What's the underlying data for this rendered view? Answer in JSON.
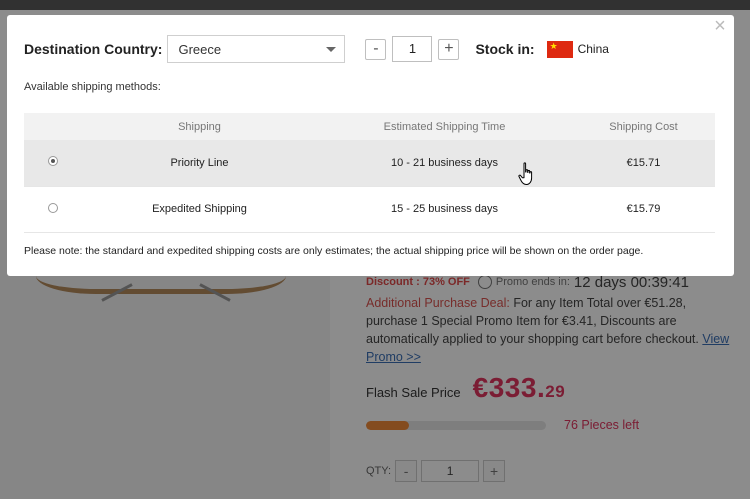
{
  "background": {
    "discount_text": "Discount : 73% OFF",
    "promo_ends_label": "Promo ends in:",
    "promo_ends_value": "12 days 00:39:41",
    "apd_title": "Additional Purchase Deal:",
    "apd_text": "For any Item Total over €51.28, purchase 1 Special Promo Item for €3.41, Discounts are automatically applied to your shopping cart before checkout.",
    "apd_link": "View Promo >>",
    "flash_label": "Flash Sale Price",
    "flash_price_main": "€333.",
    "flash_price_cents": "29",
    "pieces_left": "76 Pieces left",
    "progress_fraction": 0.24,
    "qty_label": "QTY:",
    "qty_value": "1",
    "minus": "-",
    "plus": "+"
  },
  "modal": {
    "close_symbol": "×",
    "destination_label": "Destination Country:",
    "destination_value": "Greece",
    "quantity": "1",
    "minus": "-",
    "plus": "+",
    "stock_label": "Stock in:",
    "stock_country": "China",
    "available_label": "Available shipping methods:",
    "table": {
      "headers": [
        "",
        "Shipping",
        "Estimated Shipping Time",
        "Shipping Cost"
      ],
      "rows": [
        {
          "method": "Priority Line",
          "time": "10 - 21 business days",
          "cost": "€15.71",
          "selected": true
        },
        {
          "method": "Expedited Shipping",
          "time": "15 - 25 business days",
          "cost": "€15.79",
          "selected": false
        }
      ]
    },
    "note": "Please note: the standard and expedited shipping costs are only estimates; the actual shipping price will be shown on the order page."
  },
  "colors": {
    "cost": "#d0021b",
    "flash_price": "#e0365f",
    "flag_red": "#de2910",
    "flag_star": "#ffde00"
  }
}
